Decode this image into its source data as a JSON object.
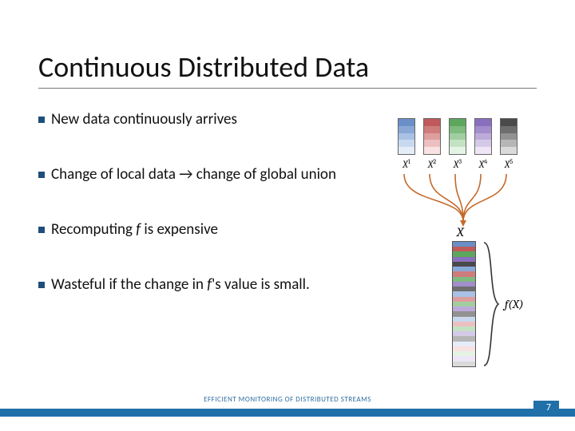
{
  "title": "Continuous Distributed Data",
  "bullets": [
    "New data continuously arrives",
    "Change of local data → change of global union",
    "Recomputing <em>f</em> is expensive",
    "Wasteful if the change in <em>f</em>'s value is small."
  ],
  "diagram": {
    "x_sources": [
      "X¹",
      "X²",
      "X³",
      "X⁴",
      "X⁵"
    ],
    "union_label": "X",
    "fx_label": "f(X)",
    "stack_colors": [
      [
        "#6a8fc8",
        "#8aa8d6",
        "#a9c1e4",
        "#c8d9ef",
        "#e5edf9"
      ],
      [
        "#c05a5a",
        "#cf7c7c",
        "#de9e9e",
        "#ecc0c0",
        "#f9e2e2"
      ],
      [
        "#5da65d",
        "#7fba7f",
        "#a1cea1",
        "#c3e2c3",
        "#e4f4e4"
      ],
      [
        "#8a6fbe",
        "#a38dcc",
        "#bcabda",
        "#d5c9e8",
        "#eee6f6"
      ],
      [
        "#4a4a4a",
        "#6e6e6e",
        "#929292",
        "#b6b6b6",
        "#dadada"
      ]
    ],
    "big_stack_colors": [
      "#6a8fc8",
      "#c05a5a",
      "#5da65d",
      "#8a6fbe",
      "#4a4a4a",
      "#8aa8d6",
      "#cf7c7c",
      "#7fba7f",
      "#a38dcc",
      "#6e6e6e",
      "#a9c1e4",
      "#de9e9e",
      "#a1cea1",
      "#bcabda",
      "#929292",
      "#c8d9ef",
      "#ecc0c0",
      "#c3e2c3",
      "#d5c9e8",
      "#b6b6b6",
      "#e5edf9",
      "#f9e2e2",
      "#e4f4e4",
      "#eee6f6",
      "#dadada"
    ]
  },
  "footer": {
    "caption": "EFFICIENT MONITORING OF DISTRIBUTED STREAMS",
    "page": "7"
  }
}
